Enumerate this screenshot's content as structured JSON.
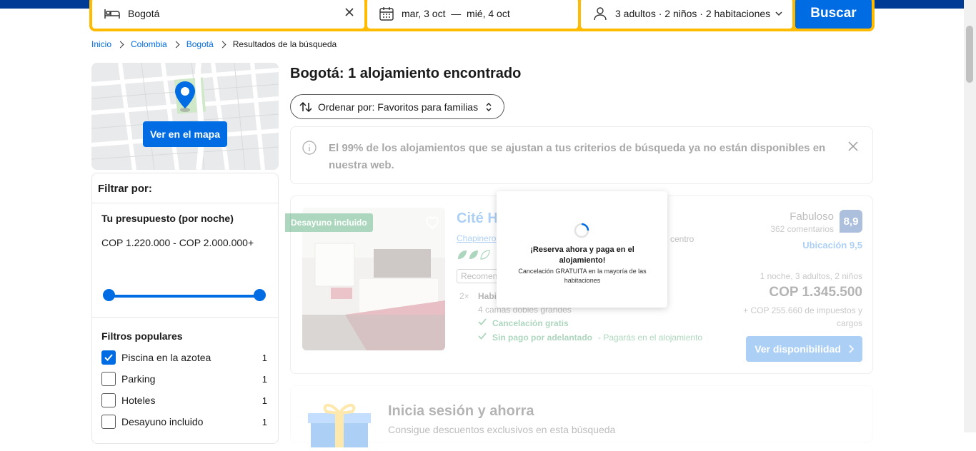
{
  "search": {
    "destination": "Bogotá",
    "dates": "mar, 3 oct  —  mié, 4 oct",
    "occupancy": "3 adultos · 2 niños · 2 habitaciones",
    "button": "Buscar"
  },
  "breadcrumb": [
    "Inicio",
    "Colombia",
    "Bogotá",
    "Resultados de la búsqueda"
  ],
  "map": {
    "button": "Ver en el mapa"
  },
  "filters": {
    "title": "Filtrar por:",
    "budget_title": "Tu presupuesto (por noche)",
    "budget_value": "COP 1.220.000 - COP 2.000.000+",
    "popular_title": "Filtros populares",
    "items": [
      {
        "label": "Piscina en la azotea",
        "count": "1",
        "checked": true
      },
      {
        "label": "Parking",
        "count": "1",
        "checked": false
      },
      {
        "label": "Hoteles",
        "count": "1",
        "checked": false
      },
      {
        "label": "Desayuno incluido",
        "count": "1",
        "checked": false
      }
    ]
  },
  "results": {
    "title": "Bogotá: 1 alojamiento encontrado",
    "sort": "Ordenar por: Favoritos para familias"
  },
  "banner": {
    "text": "El 99% de los alojamientos que se ajustan a tus criterios de búsqueda ya no están disponibles en nuestra web."
  },
  "property": {
    "tag": "Desayuno incluido",
    "name": "Cité H",
    "location": "Chapinero",
    "location_suffix": "l centro",
    "recommended": "Recomend",
    "quantity": "2×",
    "room": "Habi",
    "beds": "4 camas dobles grandes",
    "perk1": "Cancelación gratis",
    "perk2": "Sin pago por adelantado",
    "perk2_rest": "- Pagarás en el alojamiento",
    "rating_word": "Fabuloso",
    "reviews": "362 comentarios",
    "score": "8,9",
    "location_score": "Ubicación 9,5",
    "stay_meta": "1 noche, 3 adultos, 2 niños",
    "price": "COP 1.345.500",
    "taxes": "+ COP 255.660 de impuestos y cargos",
    "cta": "Ver disponibilidad"
  },
  "popup": {
    "title": "¡Reserva ahora y paga en el alojamiento!",
    "subtitle": "Cancelación GRATUITA en la mayoría de las habitaciones"
  },
  "signin": {
    "title": "Inicia sesión y ahorra",
    "subtitle": "Consigue descuentos exclusivos en esta búsqueda"
  },
  "colors": {
    "brand_blue": "#003b95",
    "action_blue": "#006ce4",
    "search_yellow": "#febb02",
    "success_green": "#008234"
  }
}
